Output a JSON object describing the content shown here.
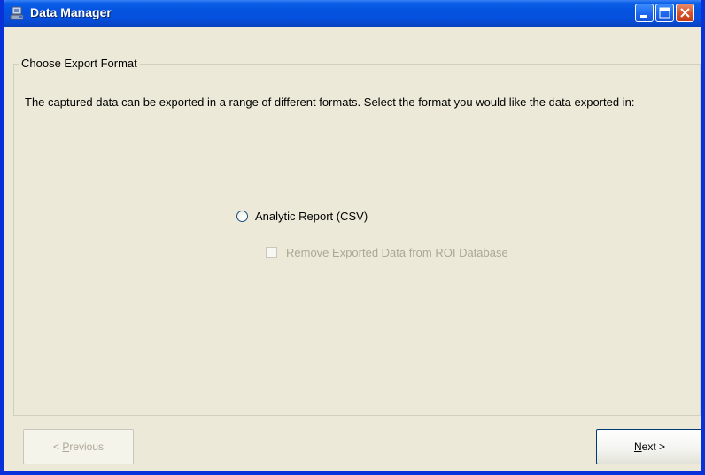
{
  "window": {
    "title": "Data Manager"
  },
  "titlebar_buttons": {
    "minimize_icon": "minimize-icon",
    "maximize_icon": "maximize-icon",
    "close_icon": "close-icon"
  },
  "group": {
    "title": "Choose Export Format",
    "description": "The captured data can be exported in a range of different formats. Select the format you would like the data exported in:"
  },
  "options": {
    "radio_label": "Analytic Report (CSV)",
    "radio_selected": false,
    "checkbox_label": "Remove Exported Data from ROI Database",
    "checkbox_checked": false,
    "checkbox_enabled": false
  },
  "buttons": {
    "previous_prefix": "< ",
    "previous_label": "Previous",
    "next_label": "Next",
    "next_suffix": " >"
  },
  "colors": {
    "titlebar": "#0553e0",
    "window_bg": "#ece9d8",
    "disabled_text": "#aca899"
  }
}
